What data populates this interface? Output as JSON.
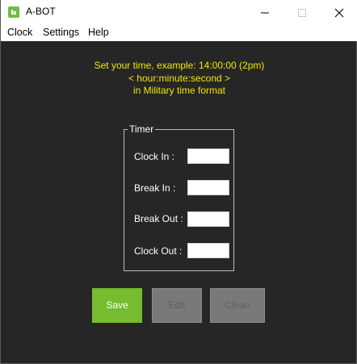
{
  "window": {
    "title": "A-BOT",
    "icon": "app-logo-icon",
    "controls": [
      "minimize-icon",
      "maximize-icon",
      "close-icon"
    ]
  },
  "menu": {
    "items": [
      "Clock",
      "Settings",
      "Help"
    ]
  },
  "instructions": {
    "line1": "Set your time, example: 14:00:00 (2pm)",
    "line2": "< hour:minute:second >",
    "line3": "in Military time format",
    "color": "#f1e700"
  },
  "timer": {
    "legend": "Timer",
    "fields": [
      {
        "label": "Clock In :",
        "value": ""
      },
      {
        "label": "Break In :",
        "value": ""
      },
      {
        "label": "Break Out :",
        "value": ""
      },
      {
        "label": "Clock Out :",
        "value": ""
      }
    ]
  },
  "buttons": {
    "save": {
      "label": "Save",
      "color": "#76bc2e",
      "enabled": true
    },
    "edit": {
      "label": "Edit",
      "enabled": false
    },
    "clean": {
      "label": "Clean",
      "enabled": false
    }
  },
  "colors": {
    "background": "#262626",
    "accent": "#76bc2e"
  }
}
